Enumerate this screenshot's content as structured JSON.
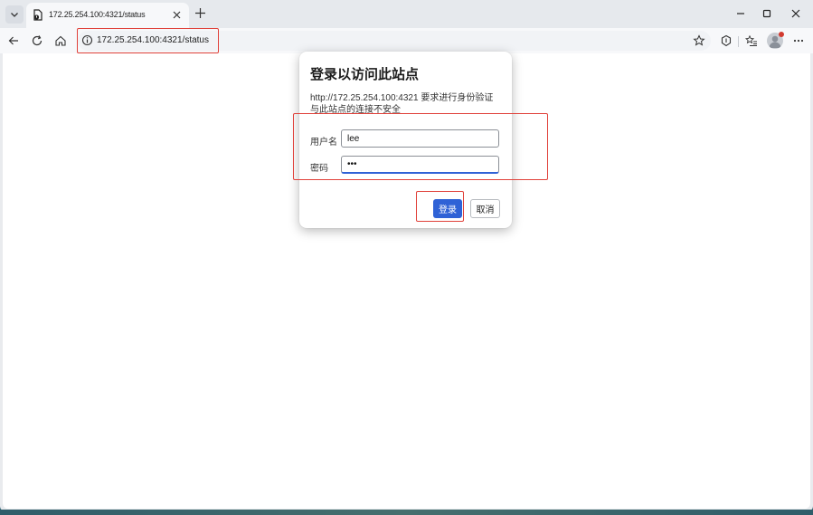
{
  "browser": {
    "tab": {
      "title": "172.25.254.100:4321/status"
    },
    "address": {
      "url": "172.25.254.100:4321/status"
    }
  },
  "dialog": {
    "title": "登录以访问此站点",
    "message_line1": "http://172.25.254.100:4321 要求进行身份验证",
    "message_line2": "与此站点的连接不安全",
    "username_label": "用户名",
    "username_value": "lee",
    "password_label": "密码",
    "password_value": "lee",
    "login_label": "登录",
    "cancel_label": "取消"
  },
  "colors": {
    "accent": "#2f62d6",
    "highlight_box": "#e0413a"
  }
}
